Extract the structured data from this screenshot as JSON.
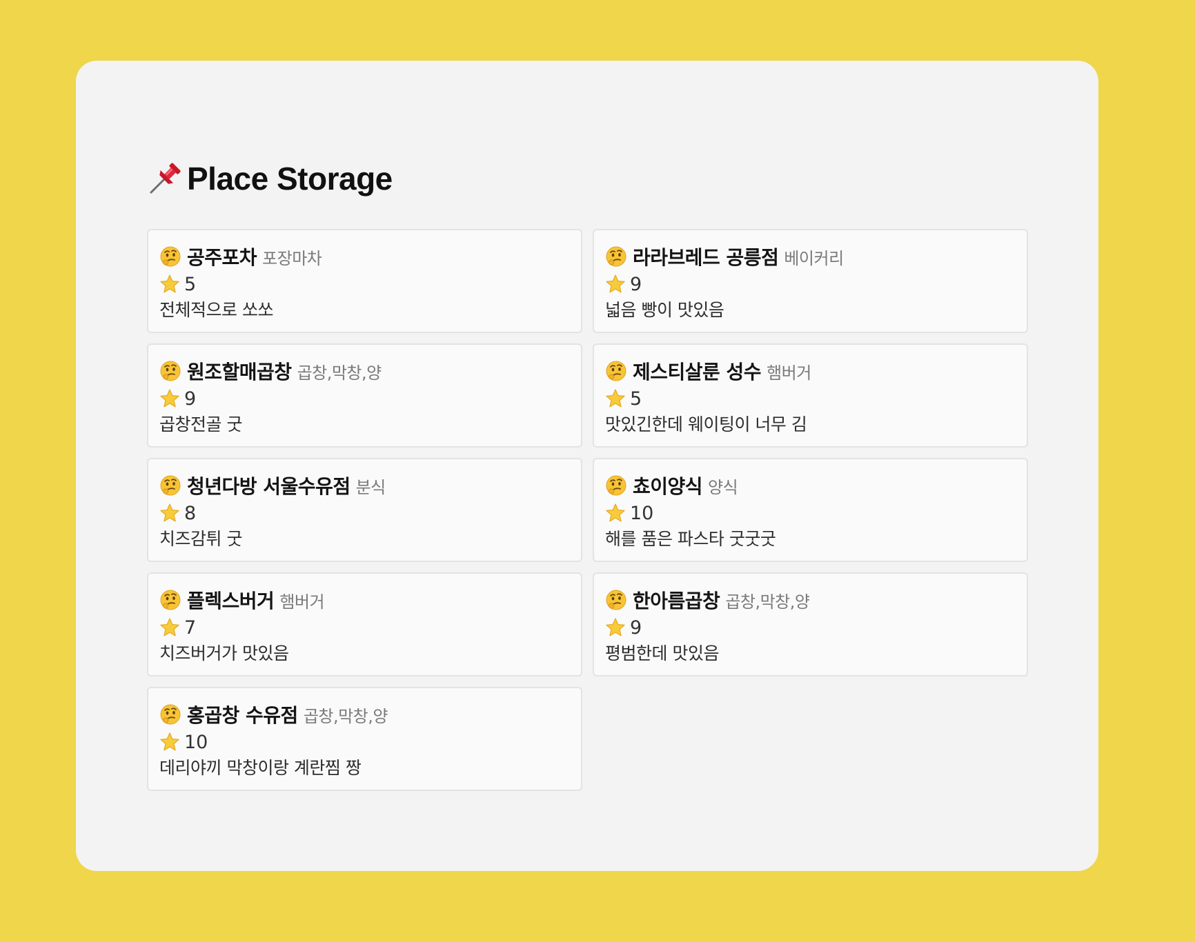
{
  "page": {
    "title": "Place Storage",
    "title_icon": "pushpin-icon"
  },
  "colors": {
    "background": "#efd64b",
    "panel": "#f3f3f3",
    "card": "#fafafa",
    "card_border": "#e3e3e3",
    "category_text": "#7a7a7a"
  },
  "places": [
    {
      "icon": "thinking-face-icon",
      "name": "공주포차",
      "category": "포장마차",
      "rating": "5",
      "comment": "전체적으로 쏘쏘"
    },
    {
      "icon": "thinking-face-icon",
      "name": "라라브레드 공릉점",
      "category": "베이커리",
      "rating": "9",
      "comment": "넓음 빵이 맛있음"
    },
    {
      "icon": "thinking-face-icon",
      "name": "원조할매곱창",
      "category": "곱창,막창,양",
      "rating": "9",
      "comment": "곱창전골 굿"
    },
    {
      "icon": "thinking-face-icon",
      "name": "제스티살룬 성수",
      "category": "햄버거",
      "rating": "5",
      "comment": "맛있긴한데 웨이팅이 너무 김"
    },
    {
      "icon": "thinking-face-icon",
      "name": "청년다방 서울수유점",
      "category": "분식",
      "rating": "8",
      "comment": "치즈감튀 굿"
    },
    {
      "icon": "thinking-face-icon",
      "name": "쵸이양식",
      "category": "양식",
      "rating": "10",
      "comment": "해를 품은 파스타 굿굿굿"
    },
    {
      "icon": "thinking-face-icon",
      "name": "플렉스버거",
      "category": "햄버거",
      "rating": "7",
      "comment": "치즈버거가 맛있음"
    },
    {
      "icon": "thinking-face-icon",
      "name": "한아름곱창",
      "category": "곱창,막창,양",
      "rating": "9",
      "comment": "평범한데 맛있음"
    },
    {
      "icon": "thinking-face-icon",
      "name": "홍곱창 수유점",
      "category": "곱창,막창,양",
      "rating": "10",
      "comment": "데리야끼 막창이랑 계란찜 짱"
    }
  ],
  "rating_icon": "star-icon"
}
